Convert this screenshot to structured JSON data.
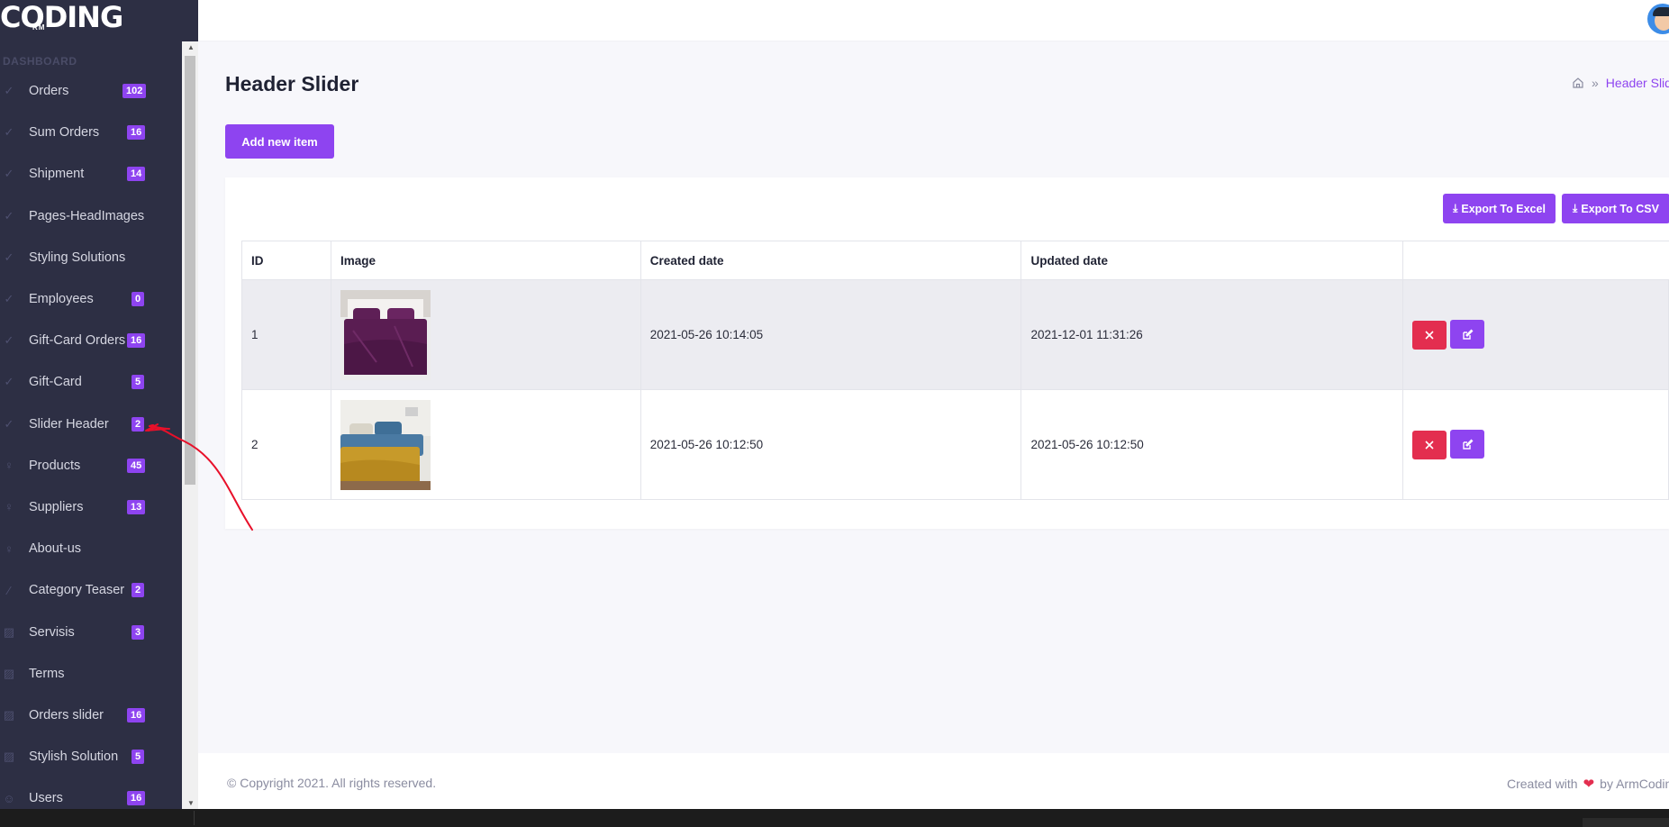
{
  "app": {
    "logo_text": "CODING",
    "logo_subtext": "RM"
  },
  "sidebar": {
    "heading": "DASHBOARD",
    "items": [
      {
        "label": "Orders",
        "badge": "102",
        "icon": "check-icon"
      },
      {
        "label": "Sum Orders",
        "badge": "16",
        "icon": "check-icon"
      },
      {
        "label": "Shipment",
        "badge": "14",
        "icon": "check-icon"
      },
      {
        "label": "Pages-HeadImages",
        "badge": "",
        "icon": "check-icon"
      },
      {
        "label": "Styling Solutions",
        "badge": "",
        "icon": "check-icon"
      },
      {
        "label": "Employees",
        "badge": "0",
        "icon": "check-icon"
      },
      {
        "label": "Gift-Card Orders",
        "badge": "16",
        "icon": "check-icon"
      },
      {
        "label": "Gift-Card",
        "badge": "5",
        "icon": "check-icon"
      },
      {
        "label": "Slider Header",
        "badge": "2",
        "icon": "check-icon"
      },
      {
        "label": "Products",
        "badge": "45",
        "icon": "bulb-icon"
      },
      {
        "label": "Suppliers",
        "badge": "13",
        "icon": "bulb-icon"
      },
      {
        "label": "About-us",
        "badge": "",
        "icon": "bulb-icon"
      },
      {
        "label": "Category Teaser",
        "badge": "2",
        "icon": "brush-icon"
      },
      {
        "label": "Servisis",
        "badge": "3",
        "icon": "image-icon"
      },
      {
        "label": "Terms",
        "badge": "",
        "icon": "image-icon"
      },
      {
        "label": "Orders slider",
        "badge": "16",
        "icon": "image-icon"
      },
      {
        "label": "Stylish Solution",
        "badge": "5",
        "icon": "image-icon"
      },
      {
        "label": "Users",
        "badge": "16",
        "icon": "user-icon"
      }
    ]
  },
  "header": {
    "page_title": "Header Slider",
    "breadcrumb_current": "Header Slider"
  },
  "toolbar": {
    "add_label": "Add new item",
    "export_excel_label": "Export To Excel",
    "export_csv_label": "Export To CSV"
  },
  "table": {
    "columns": [
      "ID",
      "Image",
      "Created date",
      "Updated date"
    ],
    "rows": [
      {
        "id": "1",
        "image": "purple-bedding",
        "created": "2021-05-26 10:14:05",
        "updated": "2021-12-01 11:31:26"
      },
      {
        "id": "2",
        "image": "mustard-blue-bedding",
        "created": "2021-05-26 10:12:50",
        "updated": "2021-05-26 10:12:50"
      }
    ]
  },
  "footer": {
    "copyright": "© Copyright 2021. All rights reserved.",
    "credit_prefix": "Created with",
    "credit_suffix": "by ArmCoding"
  },
  "colors": {
    "sidebar_bg": "#2d2f44",
    "accent": "#8e44f0",
    "danger": "#e32e4f",
    "annotation": "#e8102a"
  }
}
